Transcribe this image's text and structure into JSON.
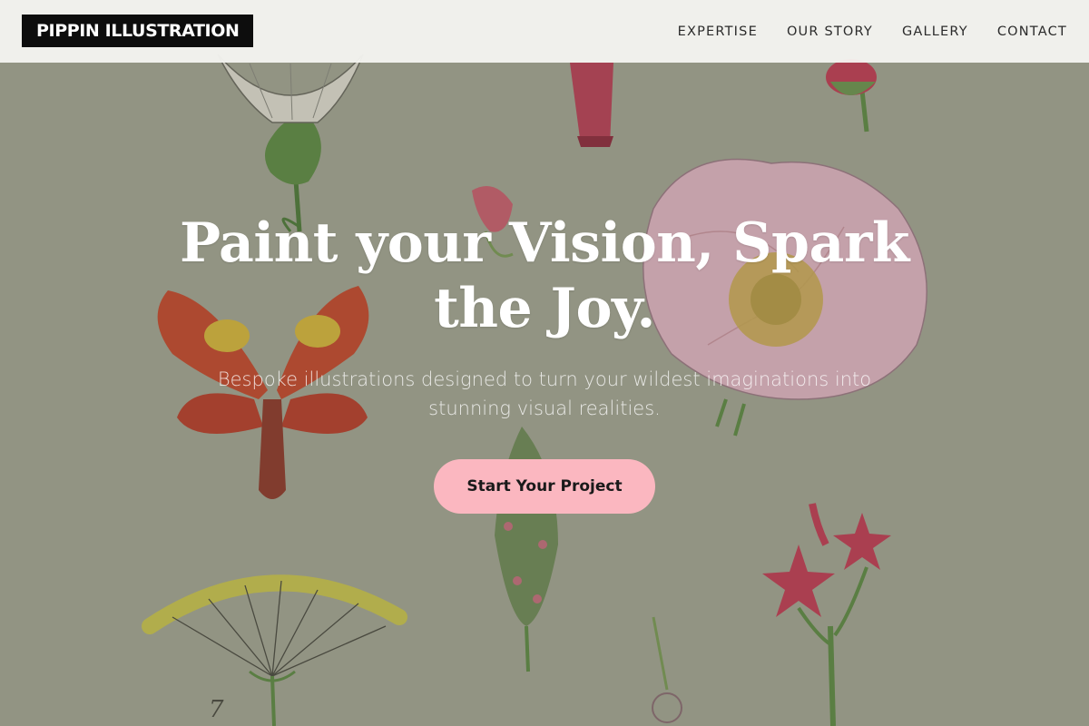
{
  "brand": {
    "name": "PIPPIN ILLUSTRATION"
  },
  "nav": {
    "items": [
      {
        "label": "EXPERTISE"
      },
      {
        "label": "OUR STORY"
      },
      {
        "label": "GALLERY"
      },
      {
        "label": "CONTACT"
      }
    ]
  },
  "hero": {
    "headline_line1": "Paint your Vision, Spark",
    "headline_line2": "the Joy.",
    "subtext_line1": "Bespoke illustrations designed to turn your wildest imaginations into",
    "subtext_line2": "stunning visual realities.",
    "cta_label": "Start Your Project",
    "plate_number": "7"
  },
  "colors": {
    "background": "#a3a593",
    "navbar": "#f8f7f4",
    "logo_bg": "#0d0d0d",
    "cta_bg": "#fbb7c0",
    "headline": "#ffffff"
  }
}
